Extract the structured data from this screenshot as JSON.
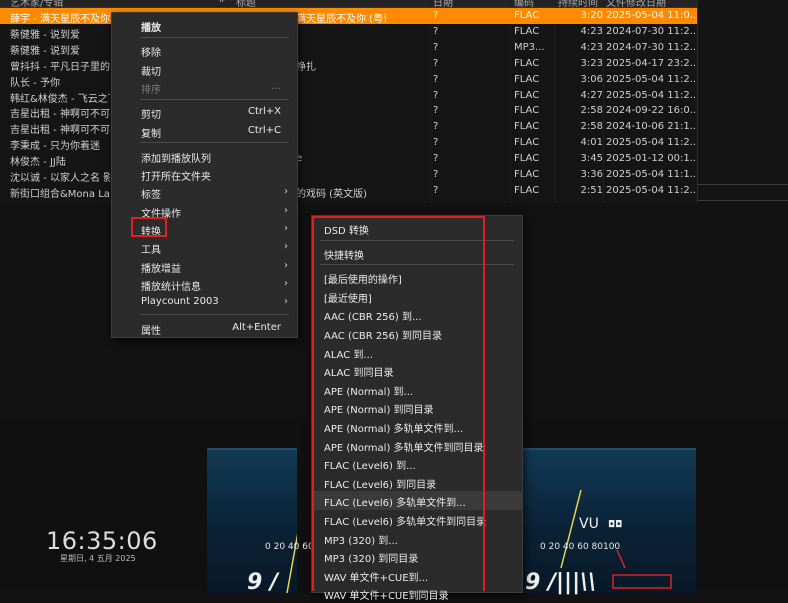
{
  "header": [
    "艺术家/专辑",
    "#",
    "标题",
    "日期",
    "编码",
    "持续时间",
    "文件修改日期"
  ],
  "rows": [
    {
      "title": "薛宇 - 满天星辰不及你 (粤语版)",
      "album": "满天星辰不及你 (粤语版)",
      "date": "?",
      "fmt": "FLAC",
      "dur": "3:20",
      "mod": "2025-05-04 11:0..."
    },
    {
      "title": "蔡健雅 - 说到爱",
      "album": "",
      "date": "?",
      "fmt": "FLAC",
      "dur": "4:23",
      "mod": "2024-07-30 11:2..."
    },
    {
      "title": "蔡健雅 - 说到爱",
      "album": "",
      "date": "?",
      "fmt": "MP3...",
      "dur": "4:23",
      "mod": "2024-07-30 11:2..."
    },
    {
      "title": "曾抖抖 - 平凡日子里的挣扎",
      "album": "挣扎",
      "date": "?",
      "fmt": "FLAC",
      "dur": "3:23",
      "mod": "2025-04-17 23:2..."
    },
    {
      "title": "队长 - 予你",
      "album": "",
      "date": "?",
      "fmt": "FLAC",
      "dur": "3:06",
      "mod": "2025-05-04 11:2..."
    },
    {
      "title": "韩红&林俊杰 - 飞云之下",
      "album": "",
      "date": "?",
      "fmt": "FLAC",
      "dur": "4:27",
      "mod": "2025-05-04 11:2..."
    },
    {
      "title": "吉星出租 - 神啊可不可以",
      "album": "",
      "date": "?",
      "fmt": "FLAC",
      "dur": "2:58",
      "mod": "2024-09-22 16:0..."
    },
    {
      "title": "吉星出租 - 神啊可不可以",
      "album": "",
      "date": "?",
      "fmt": "FLAC",
      "dur": "2:58",
      "mod": "2024-10-06 21:1..."
    },
    {
      "title": "李秉成 - 只为你着迷",
      "album": "",
      "date": "?",
      "fmt": "FLAC",
      "dur": "4:01",
      "mod": "2025-05-04 11:2..."
    },
    {
      "title": "林俊杰 - JJ陆",
      "album": "e",
      "date": "?",
      "fmt": "FLAC",
      "dur": "3:45",
      "mod": "2025-01-12 00:1..."
    },
    {
      "title": "沈以诚 - 以家人之名 影视",
      "album": "",
      "date": "?",
      "fmt": "FLAC",
      "dur": "3:36",
      "mod": "2025-05-04 11:1..."
    },
    {
      "title": "新街口组合&Mona Lav",
      "album": "的戏码 (英文版)",
      "date": "?",
      "fmt": "FLAC",
      "dur": "2:51",
      "mod": "2025-05-04 11:2..."
    }
  ],
  "context_menu": [
    {
      "label": "播放",
      "bold": true
    },
    {
      "sep": true
    },
    {
      "label": "移除"
    },
    {
      "label": "裁切"
    },
    {
      "label": "排序",
      "disabled": true,
      "extra": "..."
    },
    {
      "sep": true
    },
    {
      "label": "剪切",
      "shortcut": "Ctrl+X"
    },
    {
      "label": "复制",
      "shortcut": "Ctrl+C"
    },
    {
      "sep": true
    },
    {
      "label": "添加到播放队列"
    },
    {
      "label": "打开所在文件夹"
    },
    {
      "label": "标签",
      "submenu": true
    },
    {
      "label": "文件操作",
      "submenu": true
    },
    {
      "label": "转换",
      "submenu": true,
      "active": true
    },
    {
      "label": "工具",
      "submenu": true
    },
    {
      "label": "播放增益",
      "submenu": true
    },
    {
      "label": "播放统计信息",
      "submenu": true
    },
    {
      "label": "Playcount 2003",
      "submenu": true
    },
    {
      "sep": true
    },
    {
      "label": "属性",
      "shortcut": "Alt+Enter"
    }
  ],
  "convert_menu": [
    {
      "label": "DSD 转换"
    },
    {
      "sep": true
    },
    {
      "label": "快捷转换"
    },
    {
      "sep": true
    },
    {
      "label": "[最后使用的操作]"
    },
    {
      "label": "[最近使用]"
    },
    {
      "label": "AAC (CBR 256) 到..."
    },
    {
      "label": "AAC (CBR 256) 到同目录"
    },
    {
      "label": "ALAC 到..."
    },
    {
      "label": "ALAC 到同目录"
    },
    {
      "label": "APE (Normal) 到..."
    },
    {
      "label": "APE (Normal) 到同目录"
    },
    {
      "label": "APE (Normal) 多轨单文件到..."
    },
    {
      "label": "APE (Normal) 多轨单文件到同目录"
    },
    {
      "label": "FLAC (Level6) 到..."
    },
    {
      "label": "FLAC (Level6) 到同目录"
    },
    {
      "label": "FLAC (Level6) 多轨单文件到...",
      "hover": true
    },
    {
      "label": "FLAC (Level6) 多轨单文件到同目录"
    },
    {
      "label": "MP3 (320) 到..."
    },
    {
      "label": "MP3 (320) 到同目录"
    },
    {
      "label": "WAV 单文件+CUE到..."
    },
    {
      "label": "WAV 单文件+CUE到同目录"
    }
  ],
  "clock": {
    "time": "16:35:06",
    "date": "星期日, 4 五月 2025"
  },
  "vu": {
    "label": "VU",
    "scale": "0 20 40 60 80100"
  },
  "colors": {
    "selection": "#ff8a00",
    "highlight_box": "#e02020",
    "menu_bg": "#2b2b2b"
  }
}
